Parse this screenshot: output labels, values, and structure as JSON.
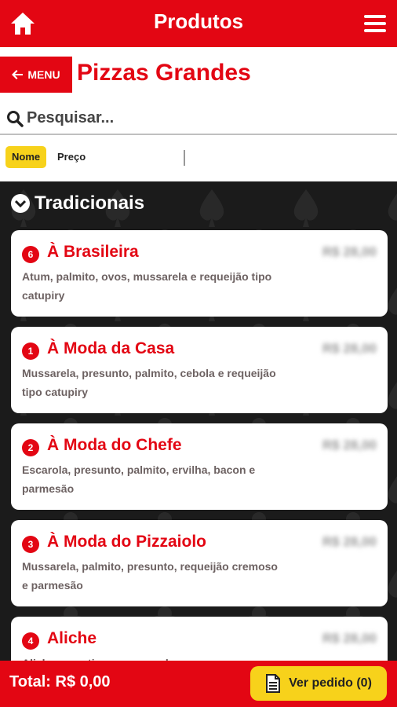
{
  "header": {
    "title": "Produtos",
    "home_icon": "home-icon",
    "menu_icon": "hamburger-icon"
  },
  "subheader": {
    "menu_label": "MENU",
    "category_title": "Pizzas Grandes"
  },
  "search": {
    "placeholder": "Pesquisar..."
  },
  "sort": {
    "name_label": "Nome",
    "price_label": "Preço",
    "active": "Nome"
  },
  "section": {
    "title": "Tradicionais"
  },
  "products": [
    {
      "badge": "6",
      "name": "À Brasileira",
      "price": "R$ 28,00",
      "description": "Atum, palmito, ovos, mussarela e requeijão tipo catupiry"
    },
    {
      "badge": "1",
      "name": "À Moda da Casa",
      "price": "R$ 28,00",
      "description": "Mussarela, presunto, palmito, cebola e requeijão tipo catupiry"
    },
    {
      "badge": "2",
      "name": "À Moda do Chefe",
      "price": "R$ 28,00",
      "description": "Escarola, presunto, palmito, ervilha, bacon e parmesão"
    },
    {
      "badge": "3",
      "name": "À Moda do Pizzaiolo",
      "price": "R$ 28,00",
      "description": "Mussarela, palmito, presunto, requeijão cremoso e parmesão"
    },
    {
      "badge": "4",
      "name": "Aliche",
      "price": "R$ 28,00",
      "description": "Aliche argentino e mussarela"
    }
  ],
  "footer": {
    "total": "Total: R$ 0,00",
    "order_button": "Ver pedido (0)"
  },
  "colors": {
    "brand_red": "#e30613",
    "accent_yellow": "#f7d21b",
    "dark_bg": "#1b1b1b"
  }
}
